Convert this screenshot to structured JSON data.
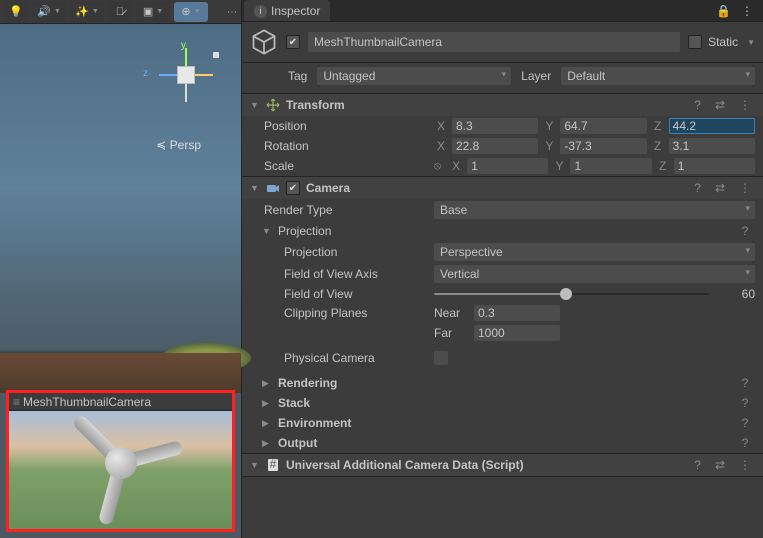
{
  "scene": {
    "persp_label": "Persp",
    "preview_title": "MeshThumbnailCamera"
  },
  "inspector": {
    "tab": "Inspector",
    "object_name": "MeshThumbnailCamera",
    "enabled": true,
    "static_label": "Static",
    "tag_label": "Tag",
    "tag_value": "Untagged",
    "layer_label": "Layer",
    "layer_value": "Default"
  },
  "transform": {
    "title": "Transform",
    "position": {
      "label": "Position",
      "x": "8.3",
      "y": "64.7",
      "z": "44.2"
    },
    "rotation": {
      "label": "Rotation",
      "x": "22.8",
      "y": "-37.3",
      "z": "3.1"
    },
    "scale": {
      "label": "Scale",
      "x": "1",
      "y": "1",
      "z": "1"
    }
  },
  "camera": {
    "title": "Camera",
    "render_type": {
      "label": "Render Type",
      "value": "Base"
    },
    "projection_section": "Projection",
    "projection": {
      "label": "Projection",
      "value": "Perspective"
    },
    "fov_axis": {
      "label": "Field of View Axis",
      "value": "Vertical"
    },
    "fov": {
      "label": "Field of View",
      "value": "60"
    },
    "clipping": {
      "label": "Clipping Planes",
      "near_label": "Near",
      "near": "0.3",
      "far_label": "Far",
      "far": "1000"
    },
    "physical": {
      "label": "Physical Camera"
    },
    "sections": {
      "rendering": "Rendering",
      "stack": "Stack",
      "environment": "Environment",
      "output": "Output"
    }
  },
  "urp": {
    "title": "Universal Additional Camera Data (Script)"
  }
}
